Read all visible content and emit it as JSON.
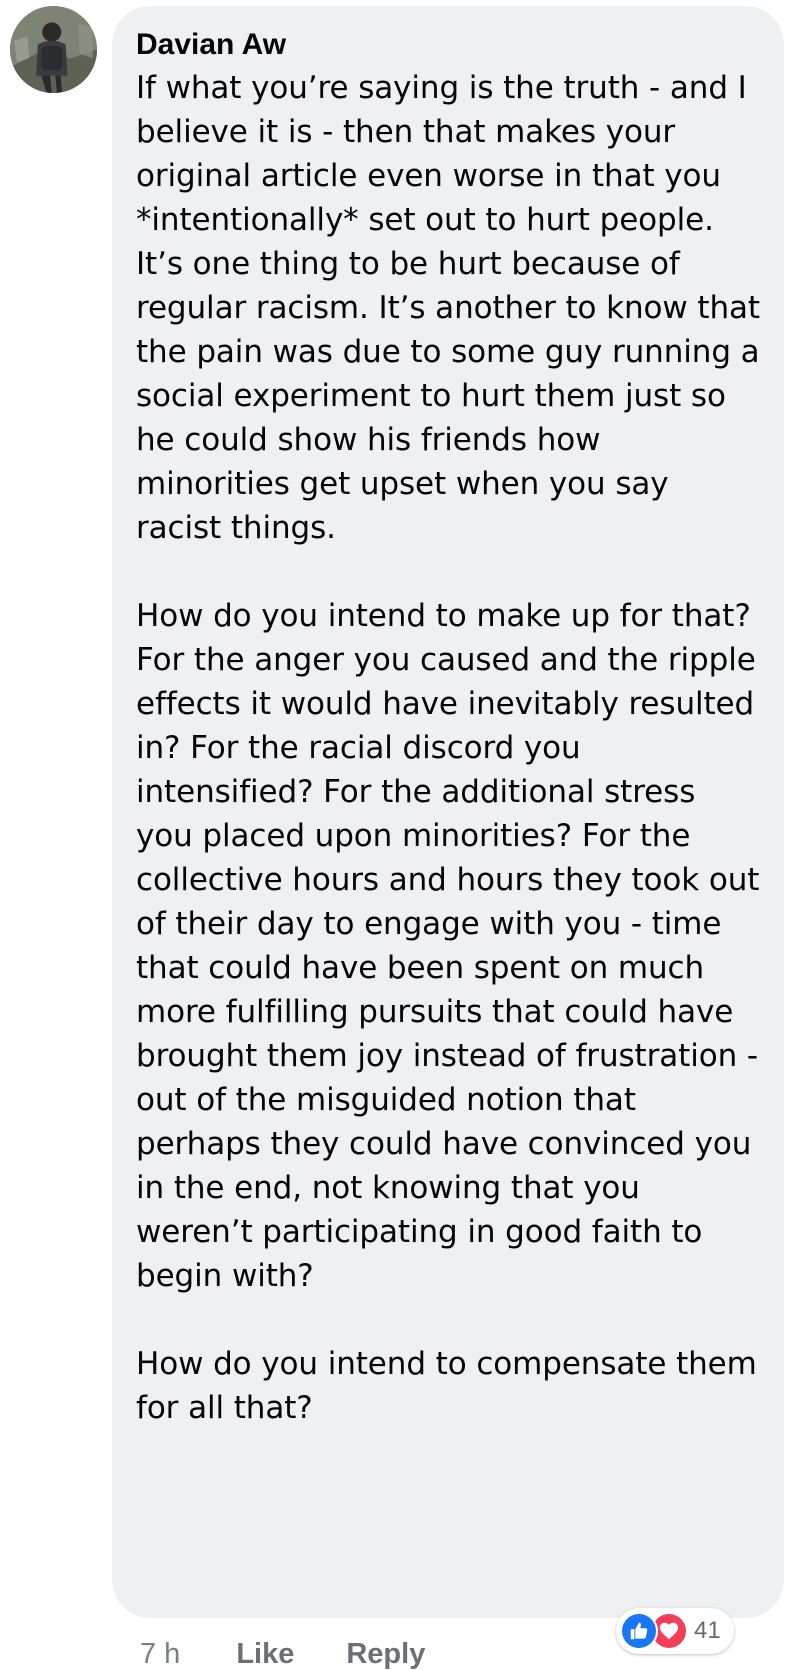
{
  "comment": {
    "author": "Davian Aw",
    "text": "If what you’re saying is the truth - and I believe it is - then that makes your original article even worse in that you *intentionally* set out to hurt people. It’s one thing to be hurt because of regular racism. It’s another to know that the pain was due to some guy running a social experiment to hurt them just so he could show his friends how minorities get upset when you say racist things.\n\nHow do you intend to make up for that? For the anger you caused and the ripple effects it would have inevitably resulted in? For the racial discord you intensified? For the additional stress you placed upon minorities? For the collective hours and hours they took out of their day to engage with you - time that could have been spent on much more fulfilling pursuits that could have brought them joy instead of frustration - out of the misguided notion that perhaps they could have convinced you in the end, not knowing that you weren’t participating in good faith to begin with?\n\nHow do you intend to compensate them for all that?",
    "timestamp": "7 h",
    "like_label": "Like",
    "reply_label": "Reply",
    "reaction_count": "41",
    "reaction_icons": [
      "like-icon",
      "love-icon"
    ]
  },
  "colors": {
    "bubble_bg": "#eff0f3",
    "like_blue": "#1877f2",
    "love_red": "#f33e58",
    "meta_gray": "#65676b"
  }
}
